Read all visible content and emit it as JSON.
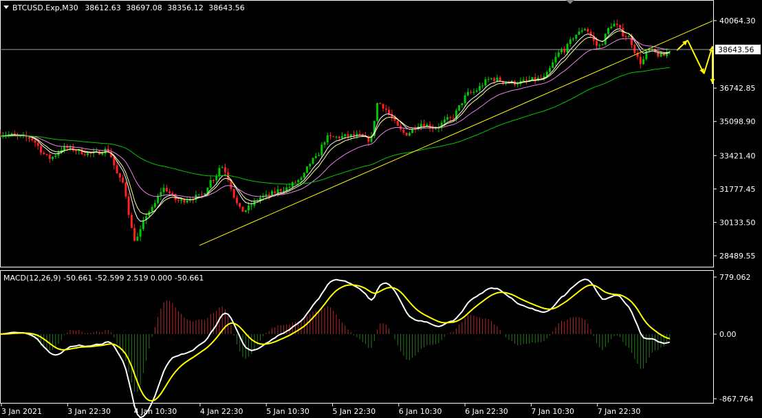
{
  "chart_data": {
    "type": "candlestick",
    "symbol_header": "BTCUSD.Exp,M30",
    "ohlc_header": {
      "open": "38612.63",
      "high": "38697.08",
      "low": "38356.12",
      "close": "38643.56"
    },
    "price_axis": {
      "ticks": [
        "40064.30",
        "36742.85",
        "35098.90",
        "33421.40",
        "31777.45",
        "30133.50",
        "28489.55"
      ],
      "ylim": [
        27960,
        41000
      ],
      "current_price": "38643.56"
    },
    "time_axis": {
      "labels": [
        "3 Jan 2021",
        "3 Jan 22:30",
        "4 Jan 10:30",
        "4 Jan 22:30",
        "5 Jan 10:30",
        "5 Jan 22:30",
        "6 Jan 10:30",
        "6 Jan 22:30",
        "7 Jan 10:30",
        "7 Jan 22:30"
      ]
    },
    "anchors": [
      {
        "t": 0.0,
        "p": 34500
      },
      {
        "t": 0.04,
        "p": 34300
      },
      {
        "t": 0.07,
        "p": 33300
      },
      {
        "t": 0.09,
        "p": 33800
      },
      {
        "t": 0.13,
        "p": 33500
      },
      {
        "t": 0.15,
        "p": 33700
      },
      {
        "t": 0.17,
        "p": 32200
      },
      {
        "t": 0.19,
        "p": 29300
      },
      {
        "t": 0.21,
        "p": 30700
      },
      {
        "t": 0.23,
        "p": 31800
      },
      {
        "t": 0.25,
        "p": 31200
      },
      {
        "t": 0.28,
        "p": 31400
      },
      {
        "t": 0.3,
        "p": 32300
      },
      {
        "t": 0.31,
        "p": 32900
      },
      {
        "t": 0.34,
        "p": 30700
      },
      {
        "t": 0.37,
        "p": 31400
      },
      {
        "t": 0.4,
        "p": 31800
      },
      {
        "t": 0.42,
        "p": 32200
      },
      {
        "t": 0.44,
        "p": 33200
      },
      {
        "t": 0.46,
        "p": 34300
      },
      {
        "t": 0.5,
        "p": 34400
      },
      {
        "t": 0.52,
        "p": 34200
      },
      {
        "t": 0.53,
        "p": 36000
      },
      {
        "t": 0.57,
        "p": 34500
      },
      {
        "t": 0.59,
        "p": 35000
      },
      {
        "t": 0.61,
        "p": 34800
      },
      {
        "t": 0.63,
        "p": 35200
      },
      {
        "t": 0.66,
        "p": 36500
      },
      {
        "t": 0.69,
        "p": 37200
      },
      {
        "t": 0.72,
        "p": 37000
      },
      {
        "t": 0.76,
        "p": 37200
      },
      {
        "t": 0.79,
        "p": 38600
      },
      {
        "t": 0.81,
        "p": 39400
      },
      {
        "t": 0.82,
        "p": 39700
      },
      {
        "t": 0.84,
        "p": 38800
      },
      {
        "t": 0.86,
        "p": 39900
      },
      {
        "t": 0.88,
        "p": 39300
      },
      {
        "t": 0.9,
        "p": 38000
      },
      {
        "t": 0.91,
        "p": 38600
      },
      {
        "t": 0.93,
        "p": 38300
      },
      {
        "t": 0.94,
        "p": 38640
      }
    ],
    "candle_count": 230,
    "moving_averages": [
      {
        "color": "#ffffff",
        "alpha": 0.28
      },
      {
        "color": "#ffff99",
        "alpha": 0.2
      },
      {
        "color": "#ee82ee",
        "alpha": 0.09
      },
      {
        "color": "#00c800",
        "alpha": 0.025
      }
    ],
    "trendline": {
      "p_start": 29000,
      "p_end": 40050,
      "t_start": 0.28,
      "t_end": 1.0
    },
    "projection": [
      {
        "t": 0.95,
        "p": 38600
      },
      {
        "t": 0.965,
        "p": 39100
      },
      {
        "t": 0.988,
        "p": 37450
      },
      {
        "t": 1.02,
        "p": 38800
      },
      {
        "t": 1.05,
        "p": 36950
      }
    ],
    "macd_panel": {
      "label": "MACD(12,26,9) -50.661 -52.599 2.519 0.000 -50.661",
      "ticks": [
        "779.062",
        "0.00",
        "-867.764"
      ],
      "ylim": [
        -867.764,
        779.062
      ]
    },
    "colors": {
      "background": "#000000",
      "bull": "#00c800",
      "bear": "#ff2020",
      "grid_frame": "#ffffff",
      "trendline": "#ffff00",
      "macd_main": "#ffffff",
      "macd_signal": "#ffff00",
      "hist_pos": "#b42828",
      "hist_neg": "#28781e",
      "price_box": "#ffffff"
    }
  }
}
